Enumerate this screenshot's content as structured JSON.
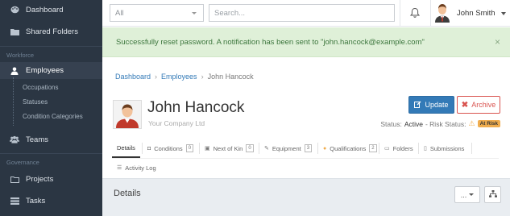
{
  "sidebar": {
    "items": [
      {
        "label": "Dashboard",
        "icon": "palette-icon"
      },
      {
        "label": "Shared Folders",
        "icon": "folder-icon"
      }
    ],
    "section_workforce": "Workforce",
    "employees": {
      "label": "Employees",
      "icon": "user-icon"
    },
    "sub_items": [
      "Occupations",
      "Statuses",
      "Condition Categories"
    ],
    "teams": {
      "label": "Teams",
      "icon": "users-icon"
    },
    "section_governance": "Governance",
    "projects": {
      "label": "Projects",
      "icon": "folder-open-icon"
    },
    "tasks": {
      "label": "Tasks",
      "icon": "tasks-icon"
    }
  },
  "topbar": {
    "filter_value": "All",
    "search_placeholder": "Search...",
    "user_name": "John Smith"
  },
  "alert": {
    "message": "Successfully reset password. A notification has been sent to \"john.hancock@example.com\"",
    "close": "×"
  },
  "breadcrumb": {
    "items": [
      "Dashboard",
      "Employees",
      "John Hancock"
    ],
    "separator": "›"
  },
  "profile": {
    "name": "John Hancock",
    "company": "Your Company Ltd",
    "status_label": "Status:",
    "status_value": "Active",
    "risk_label": "- Risk Status:",
    "risk_value": "At Risk",
    "update_label": "Update",
    "archive_label": "Archive"
  },
  "tabs": [
    {
      "label": "Details",
      "count": null
    },
    {
      "label": "Conditions",
      "count": "0"
    },
    {
      "label": "Next of Kin",
      "count": "0"
    },
    {
      "label": "Equipment",
      "count": "3"
    },
    {
      "label": "Qualifications",
      "count": "2"
    },
    {
      "label": "Folders",
      "count": null
    },
    {
      "label": "Submissions",
      "count": null
    },
    {
      "label": "Activity Log",
      "count": null
    }
  ],
  "details_panel": {
    "title": "Details",
    "more_label": "..."
  },
  "colors": {
    "sidebar_bg": "#2b3643",
    "primary": "#337ab7",
    "danger": "#d9534f",
    "warning": "#f0ad4e",
    "success_bg": "#dff0d8"
  }
}
